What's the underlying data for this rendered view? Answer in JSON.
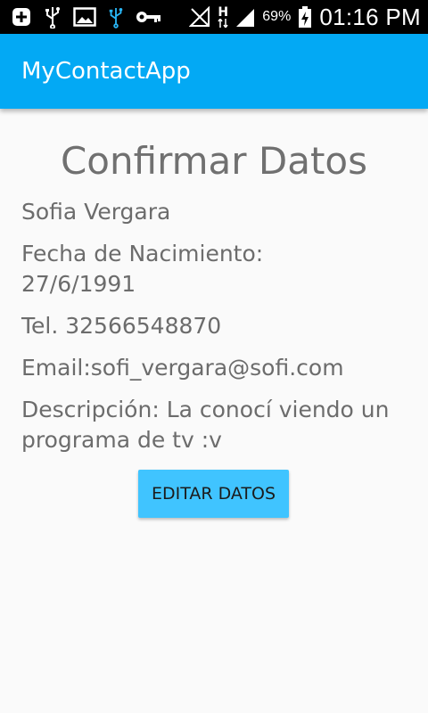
{
  "status_bar": {
    "icons": [
      "add-box-icon",
      "usb-icon",
      "image-icon",
      "usb-debug-icon",
      "vpn-key-icon",
      "signal-off-icon",
      "hspa-icon",
      "signal-bars-icon",
      "battery-charging-icon"
    ],
    "network_label": "H",
    "battery_percent": "69%",
    "time": "01:16 PM"
  },
  "app_bar": {
    "title": "MyContactApp",
    "color": "#03a9f4"
  },
  "main": {
    "title": "Confirmar Datos",
    "name": "Sofia Vergara",
    "birth_date": "Fecha de Nacimiento: 27/6/1991",
    "phone": "Tel. 32566548870",
    "email": "Email:sofi_vergara@sofi.com",
    "description": "Descripción: La conocí viendo un programa de tv :v",
    "edit_button_label": "EDITAR DATOS",
    "button_color": "#40c4ff"
  }
}
